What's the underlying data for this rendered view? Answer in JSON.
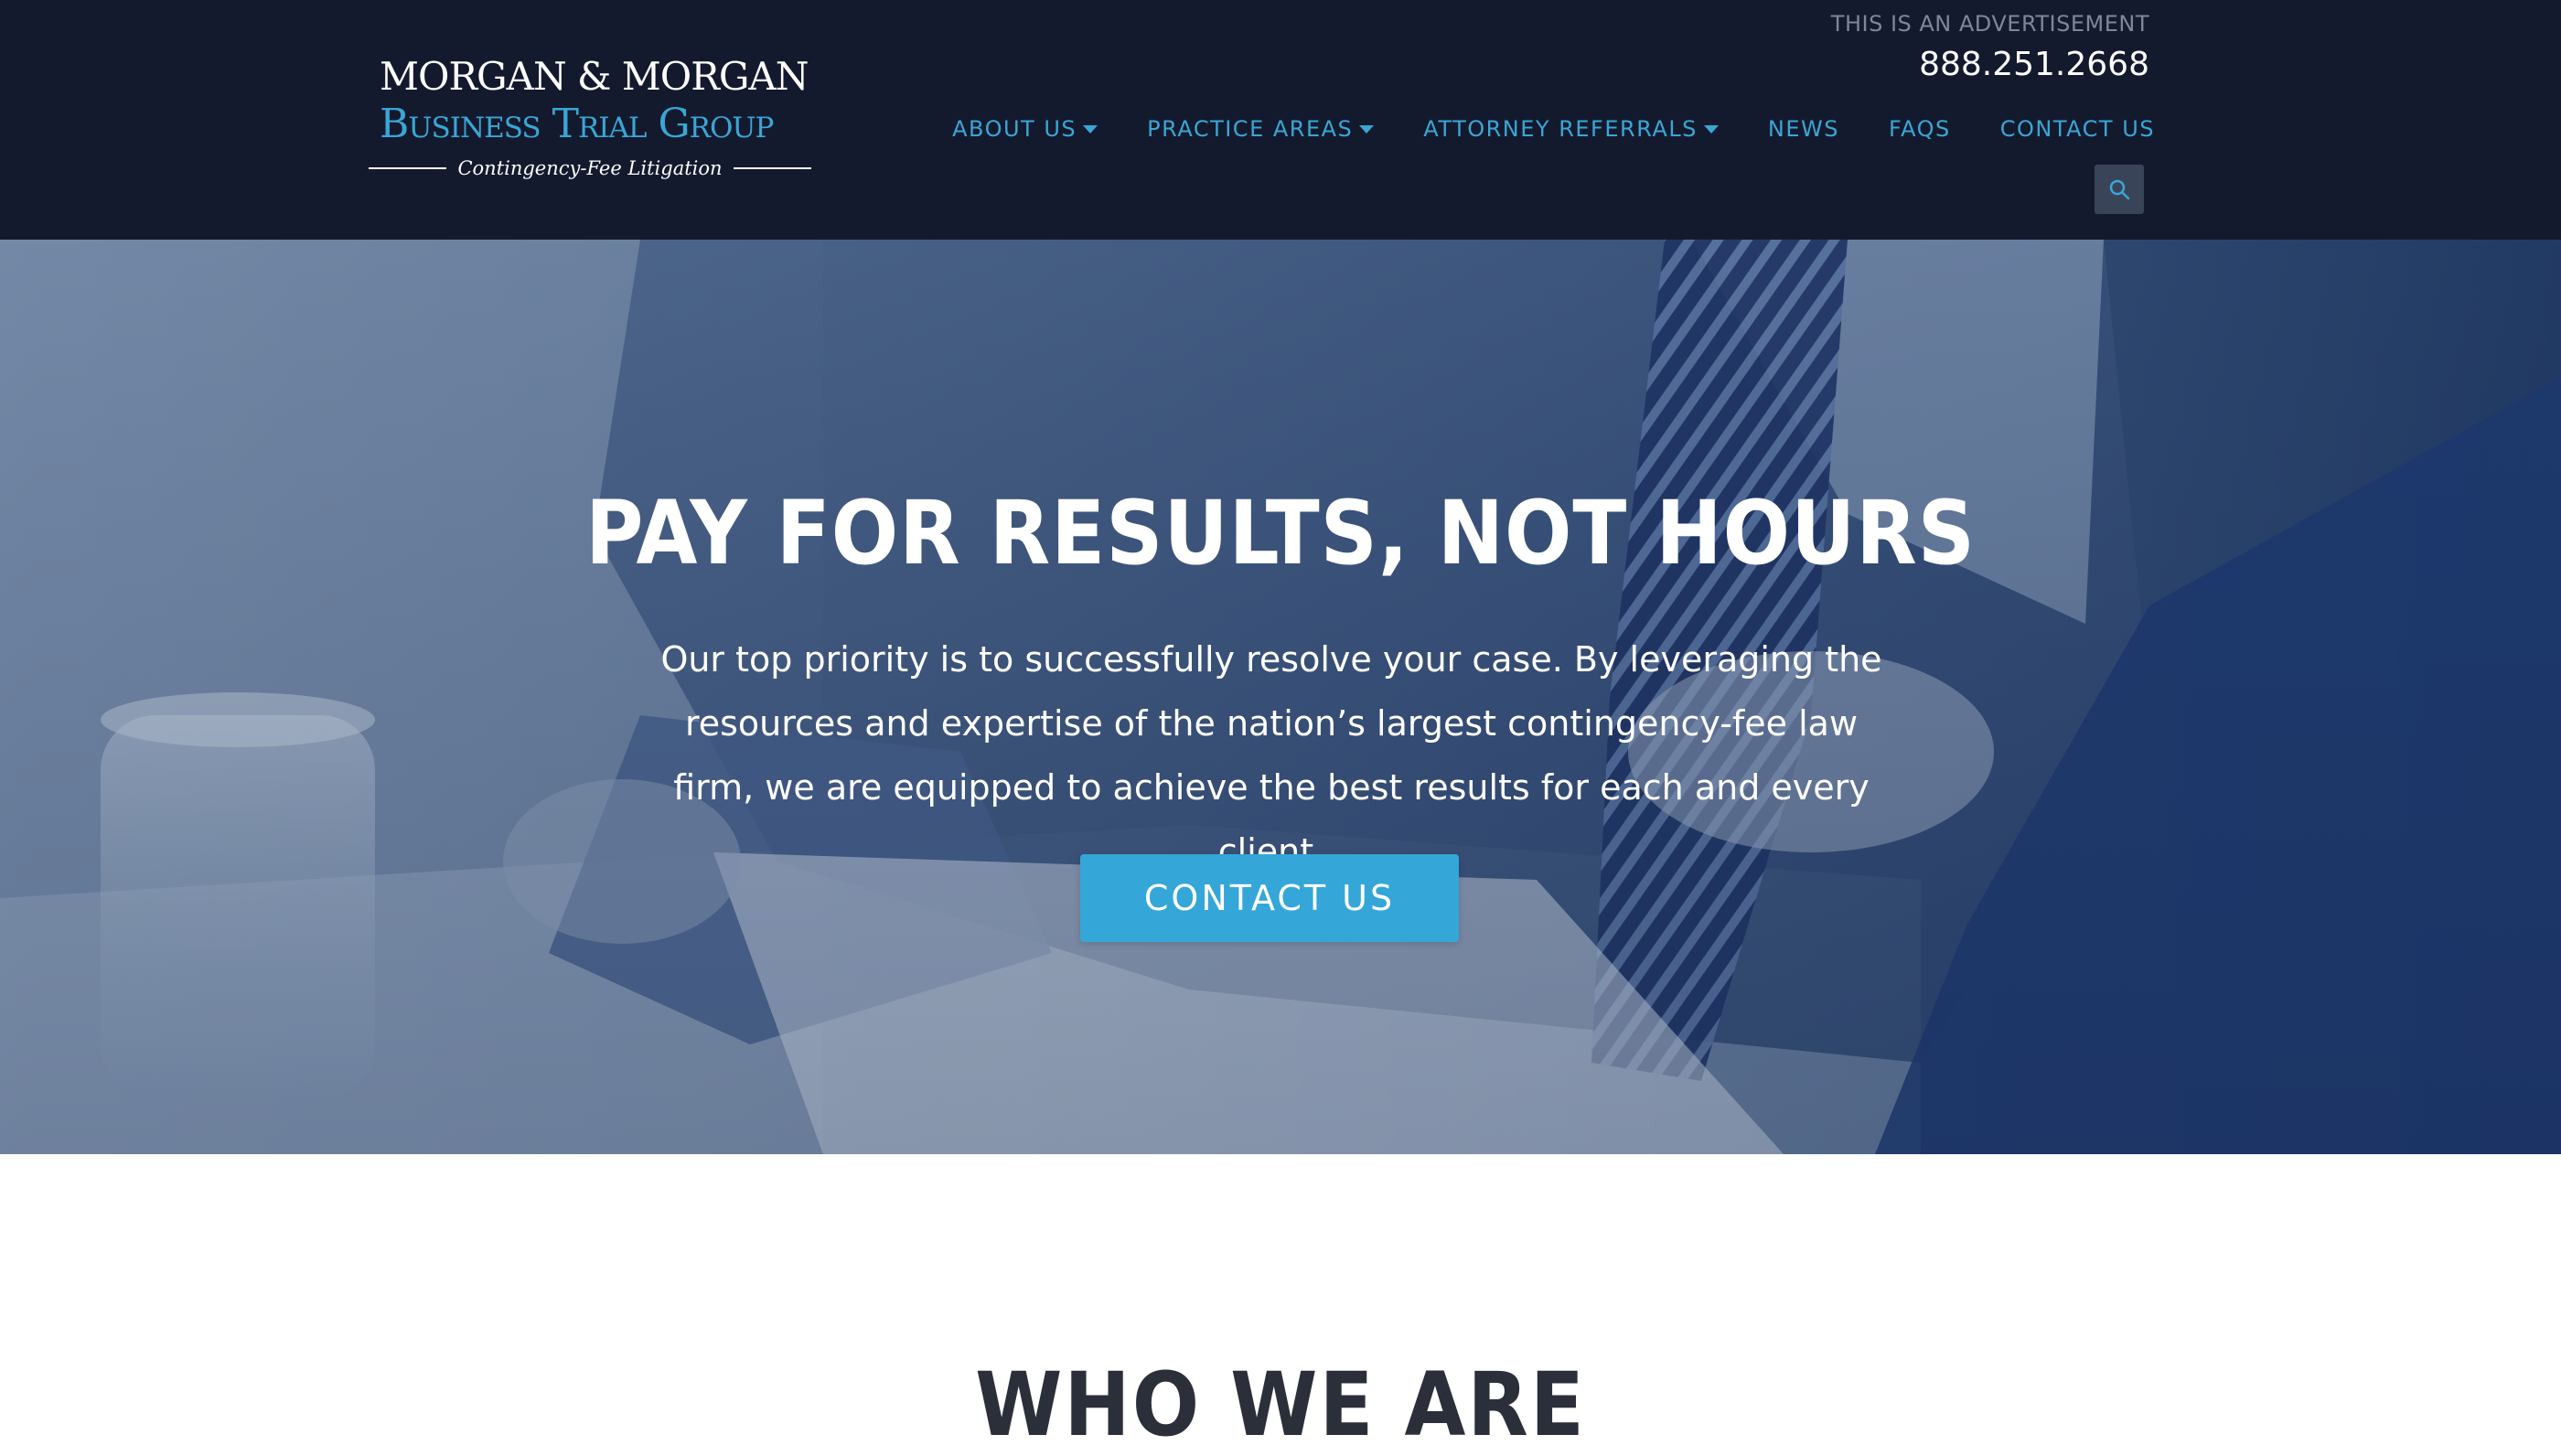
{
  "brand": {
    "line1": "MORGAN & MORGAN",
    "line2": "Business Trial Group",
    "tagline": "Contingency-Fee Litigation"
  },
  "header": {
    "ad_notice": "THIS IS AN ADVERTISEMENT",
    "phone": "888.251.2668"
  },
  "nav": {
    "items": [
      {
        "label": "ABOUT US",
        "dropdown": true
      },
      {
        "label": "PRACTICE AREAS",
        "dropdown": true
      },
      {
        "label": "ATTORNEY REFERRALS",
        "dropdown": true
      },
      {
        "label": "NEWS",
        "dropdown": false
      },
      {
        "label": "FAQS",
        "dropdown": false
      },
      {
        "label": "CONTACT US",
        "dropdown": false
      }
    ],
    "search_icon": "search-icon"
  },
  "hero": {
    "title": "PAY FOR RESULTS, NOT HOURS",
    "text": "Our top priority is to successfully resolve your case. By leveraging the resources and expertise of the nation’s largest contingency-fee law firm, we are equipped to achieve the best results for each and every client.",
    "cta_label": "CONTACT US"
  },
  "section": {
    "title": "WHO WE ARE"
  },
  "colors": {
    "header_bg": "#141a2e",
    "accent": "#3aa6d6",
    "cta_bg": "#34a6d8",
    "section_title": "#2a2f3a"
  }
}
